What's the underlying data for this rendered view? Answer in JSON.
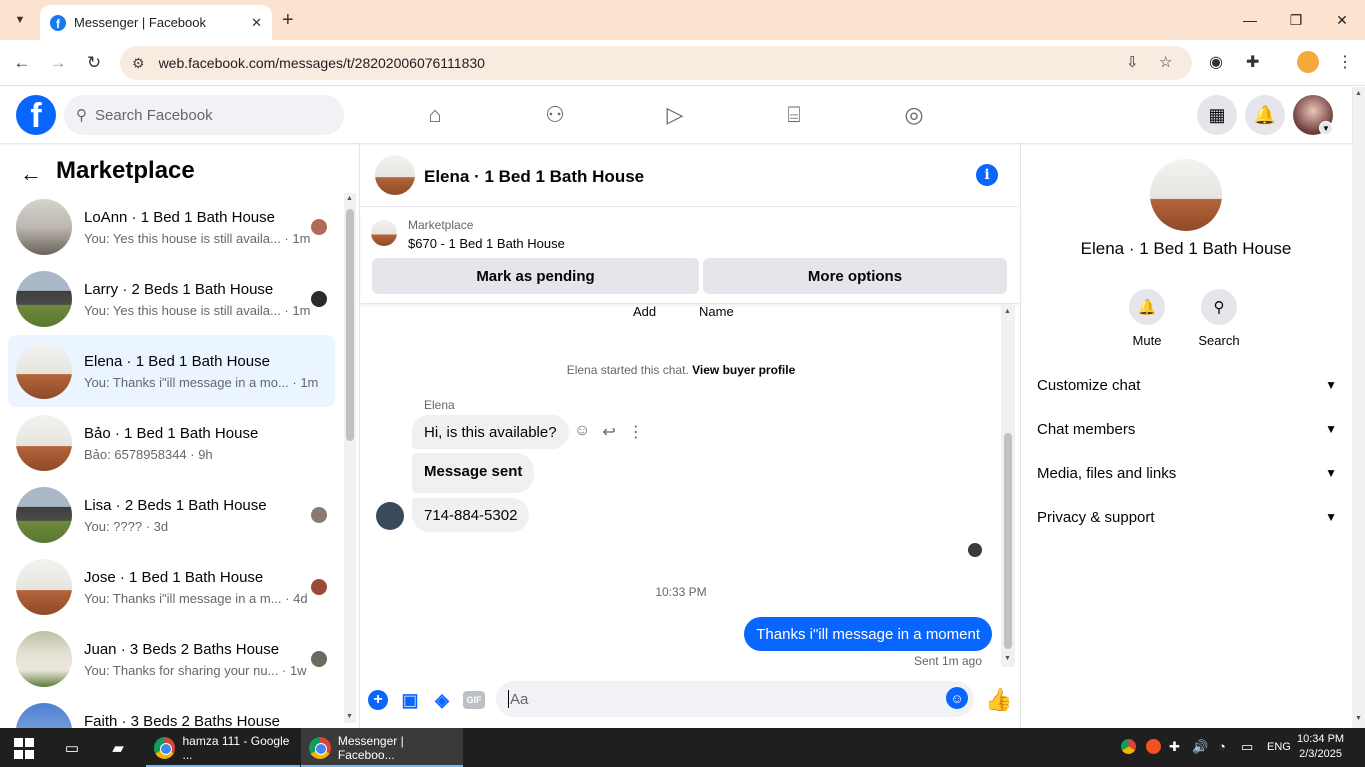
{
  "browser": {
    "tab_title": "Messenger | Facebook",
    "url": "web.facebook.com/messages/t/28202006076111830",
    "new_tab": "+",
    "window_controls": {
      "minimize": "—",
      "maximize": "❐",
      "close": "✕"
    }
  },
  "fb_header": {
    "logo_letter": "f",
    "search_placeholder": "Search Facebook"
  },
  "sidebar": {
    "title": "Marketplace",
    "conversations": [
      {
        "name": "LoAnn · 1 Bed 1 Bath House",
        "preview": "You: Yes this house is still availa... · 1m",
        "active": false
      },
      {
        "name": "Larry · 2 Beds 1 Bath House",
        "preview": "You: Yes this house is still availa... · 1m",
        "active": false
      },
      {
        "name": "Elena · 1 Bed 1 Bath House",
        "preview": "You: Thanks i\"ill message in a mo... · 1m",
        "active": true
      },
      {
        "name": "Bảo · 1 Bed 1 Bath House",
        "preview": "Bảo: 6578958344 · 9h",
        "active": false
      },
      {
        "name": "Lisa · 2 Beds 1 Bath House",
        "preview": "You: ???? · 3d",
        "active": false
      },
      {
        "name": "Jose · 1 Bed 1 Bath House",
        "preview": "You: Thanks i\"ill message in a m... · 4d",
        "active": false
      },
      {
        "name": "Juan · 3 Beds 2 Baths House",
        "preview": "You: Thanks for sharing your nu... · 1w",
        "active": false
      },
      {
        "name": "Faith · 3 Beds 2 Baths House",
        "preview": "",
        "active": false
      }
    ]
  },
  "chat": {
    "title": "Elena · 1 Bed 1 Bath House",
    "listing_category": "Marketplace",
    "listing_price": "$670 - 1 Bed 1 Bath House",
    "mark_pending_label": "Mark as pending",
    "more_options_label": "More options",
    "cut_add": "Add",
    "cut_name": "Name",
    "system_prefix": "Elena started this chat.",
    "system_link": "View buyer profile",
    "sender_name": "Elena",
    "messages": [
      {
        "text": "Hi, is this available?"
      },
      {
        "text": "Message sent"
      },
      {
        "text": "714-884-5302"
      }
    ],
    "time_divider": "10:33 PM",
    "my_message": "Thanks i\"ill message in a moment",
    "sent_status": "Sent 1m ago",
    "composer_placeholder": "Aa",
    "gif_label": "GIF"
  },
  "right_panel": {
    "name": "Elena · 1 Bed 1 Bath House",
    "mute_label": "Mute",
    "search_label": "Search",
    "sections": [
      {
        "label": "Customize chat"
      },
      {
        "label": "Chat members"
      },
      {
        "label": "Media, files and links"
      },
      {
        "label": "Privacy & support"
      }
    ]
  },
  "taskbar": {
    "apps": [
      {
        "label": "hamza 111 - Google ..."
      },
      {
        "label": "Messenger | Faceboo..."
      }
    ],
    "language": "ENG",
    "time": "10:34 PM",
    "date": "2/3/2025"
  },
  "colors": {
    "fb_blue": "#0866ff",
    "active_conv": "#ebf5ff",
    "tab_bar": "#fbe3cf"
  }
}
